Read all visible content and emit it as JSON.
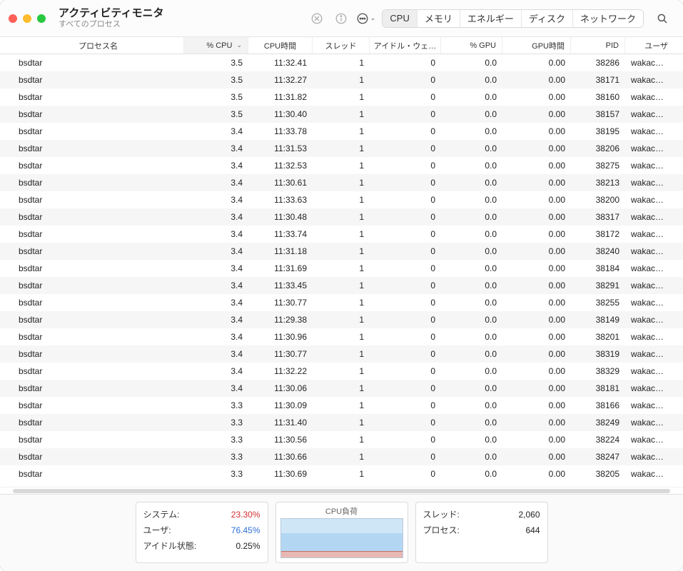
{
  "window": {
    "title": "アクティビティモニタ",
    "subtitle": "すべてのプロセス"
  },
  "tabs": {
    "cpu": "CPU",
    "memory": "メモリ",
    "energy": "エネルギー",
    "disk": "ディスク",
    "network": "ネットワーク"
  },
  "columns": {
    "name": "プロセス名",
    "cpu": "% CPU",
    "time": "CPU時間",
    "threads": "スレッド",
    "idle": "アイドル・ウェ…",
    "gpu": "% GPU",
    "gputime": "GPU時間",
    "pid": "PID",
    "user": "ユーザ"
  },
  "rows": [
    {
      "name": "bsdtar",
      "cpu": "3.5",
      "time": "11:32.41",
      "threads": "1",
      "idle": "0",
      "gpu": "0.0",
      "gputime": "0.00",
      "pid": "38286",
      "user": "wakachan"
    },
    {
      "name": "bsdtar",
      "cpu": "3.5",
      "time": "11:32.27",
      "threads": "1",
      "idle": "0",
      "gpu": "0.0",
      "gputime": "0.00",
      "pid": "38171",
      "user": "wakachan"
    },
    {
      "name": "bsdtar",
      "cpu": "3.5",
      "time": "11:31.82",
      "threads": "1",
      "idle": "0",
      "gpu": "0.0",
      "gputime": "0.00",
      "pid": "38160",
      "user": "wakachan"
    },
    {
      "name": "bsdtar",
      "cpu": "3.5",
      "time": "11:30.40",
      "threads": "1",
      "idle": "0",
      "gpu": "0.0",
      "gputime": "0.00",
      "pid": "38157",
      "user": "wakachan"
    },
    {
      "name": "bsdtar",
      "cpu": "3.4",
      "time": "11:33.78",
      "threads": "1",
      "idle": "0",
      "gpu": "0.0",
      "gputime": "0.00",
      "pid": "38195",
      "user": "wakachan"
    },
    {
      "name": "bsdtar",
      "cpu": "3.4",
      "time": "11:31.53",
      "threads": "1",
      "idle": "0",
      "gpu": "0.0",
      "gputime": "0.00",
      "pid": "38206",
      "user": "wakachan"
    },
    {
      "name": "bsdtar",
      "cpu": "3.4",
      "time": "11:32.53",
      "threads": "1",
      "idle": "0",
      "gpu": "0.0",
      "gputime": "0.00",
      "pid": "38275",
      "user": "wakachan"
    },
    {
      "name": "bsdtar",
      "cpu": "3.4",
      "time": "11:30.61",
      "threads": "1",
      "idle": "0",
      "gpu": "0.0",
      "gputime": "0.00",
      "pid": "38213",
      "user": "wakachan"
    },
    {
      "name": "bsdtar",
      "cpu": "3.4",
      "time": "11:33.63",
      "threads": "1",
      "idle": "0",
      "gpu": "0.0",
      "gputime": "0.00",
      "pid": "38200",
      "user": "wakachan"
    },
    {
      "name": "bsdtar",
      "cpu": "3.4",
      "time": "11:30.48",
      "threads": "1",
      "idle": "0",
      "gpu": "0.0",
      "gputime": "0.00",
      "pid": "38317",
      "user": "wakachan"
    },
    {
      "name": "bsdtar",
      "cpu": "3.4",
      "time": "11:33.74",
      "threads": "1",
      "idle": "0",
      "gpu": "0.0",
      "gputime": "0.00",
      "pid": "38172",
      "user": "wakachan"
    },
    {
      "name": "bsdtar",
      "cpu": "3.4",
      "time": "11:31.18",
      "threads": "1",
      "idle": "0",
      "gpu": "0.0",
      "gputime": "0.00",
      "pid": "38240",
      "user": "wakachan"
    },
    {
      "name": "bsdtar",
      "cpu": "3.4",
      "time": "11:31.69",
      "threads": "1",
      "idle": "0",
      "gpu": "0.0",
      "gputime": "0.00",
      "pid": "38184",
      "user": "wakachan"
    },
    {
      "name": "bsdtar",
      "cpu": "3.4",
      "time": "11:33.45",
      "threads": "1",
      "idle": "0",
      "gpu": "0.0",
      "gputime": "0.00",
      "pid": "38291",
      "user": "wakachan"
    },
    {
      "name": "bsdtar",
      "cpu": "3.4",
      "time": "11:30.77",
      "threads": "1",
      "idle": "0",
      "gpu": "0.0",
      "gputime": "0.00",
      "pid": "38255",
      "user": "wakachan"
    },
    {
      "name": "bsdtar",
      "cpu": "3.4",
      "time": "11:29.38",
      "threads": "1",
      "idle": "0",
      "gpu": "0.0",
      "gputime": "0.00",
      "pid": "38149",
      "user": "wakachan"
    },
    {
      "name": "bsdtar",
      "cpu": "3.4",
      "time": "11:30.96",
      "threads": "1",
      "idle": "0",
      "gpu": "0.0",
      "gputime": "0.00",
      "pid": "38201",
      "user": "wakachan"
    },
    {
      "name": "bsdtar",
      "cpu": "3.4",
      "time": "11:30.77",
      "threads": "1",
      "idle": "0",
      "gpu": "0.0",
      "gputime": "0.00",
      "pid": "38319",
      "user": "wakachan"
    },
    {
      "name": "bsdtar",
      "cpu": "3.4",
      "time": "11:32.22",
      "threads": "1",
      "idle": "0",
      "gpu": "0.0",
      "gputime": "0.00",
      "pid": "38329",
      "user": "wakachan"
    },
    {
      "name": "bsdtar",
      "cpu": "3.4",
      "time": "11:30.06",
      "threads": "1",
      "idle": "0",
      "gpu": "0.0",
      "gputime": "0.00",
      "pid": "38181",
      "user": "wakachan"
    },
    {
      "name": "bsdtar",
      "cpu": "3.3",
      "time": "11:30.09",
      "threads": "1",
      "idle": "0",
      "gpu": "0.0",
      "gputime": "0.00",
      "pid": "38166",
      "user": "wakachan"
    },
    {
      "name": "bsdtar",
      "cpu": "3.3",
      "time": "11:31.40",
      "threads": "1",
      "idle": "0",
      "gpu": "0.0",
      "gputime": "0.00",
      "pid": "38249",
      "user": "wakachan"
    },
    {
      "name": "bsdtar",
      "cpu": "3.3",
      "time": "11:30.56",
      "threads": "1",
      "idle": "0",
      "gpu": "0.0",
      "gputime": "0.00",
      "pid": "38224",
      "user": "wakachan"
    },
    {
      "name": "bsdtar",
      "cpu": "3.3",
      "time": "11:30.66",
      "threads": "1",
      "idle": "0",
      "gpu": "0.0",
      "gputime": "0.00",
      "pid": "38247",
      "user": "wakachan"
    },
    {
      "name": "bsdtar",
      "cpu": "3.3",
      "time": "11:30.69",
      "threads": "1",
      "idle": "0",
      "gpu": "0.0",
      "gputime": "0.00",
      "pid": "38205",
      "user": "wakachan"
    }
  ],
  "footer": {
    "left": {
      "system_label": "システム:",
      "system_value": "23.30%",
      "user_label": "ユーザ:",
      "user_value": "76.45%",
      "idle_label": "アイドル状態:",
      "idle_value": "0.25%"
    },
    "chart_title": "CPU負荷",
    "right": {
      "threads_label": "スレッド:",
      "threads_value": "2,060",
      "processes_label": "プロセス:",
      "processes_value": "644"
    }
  }
}
